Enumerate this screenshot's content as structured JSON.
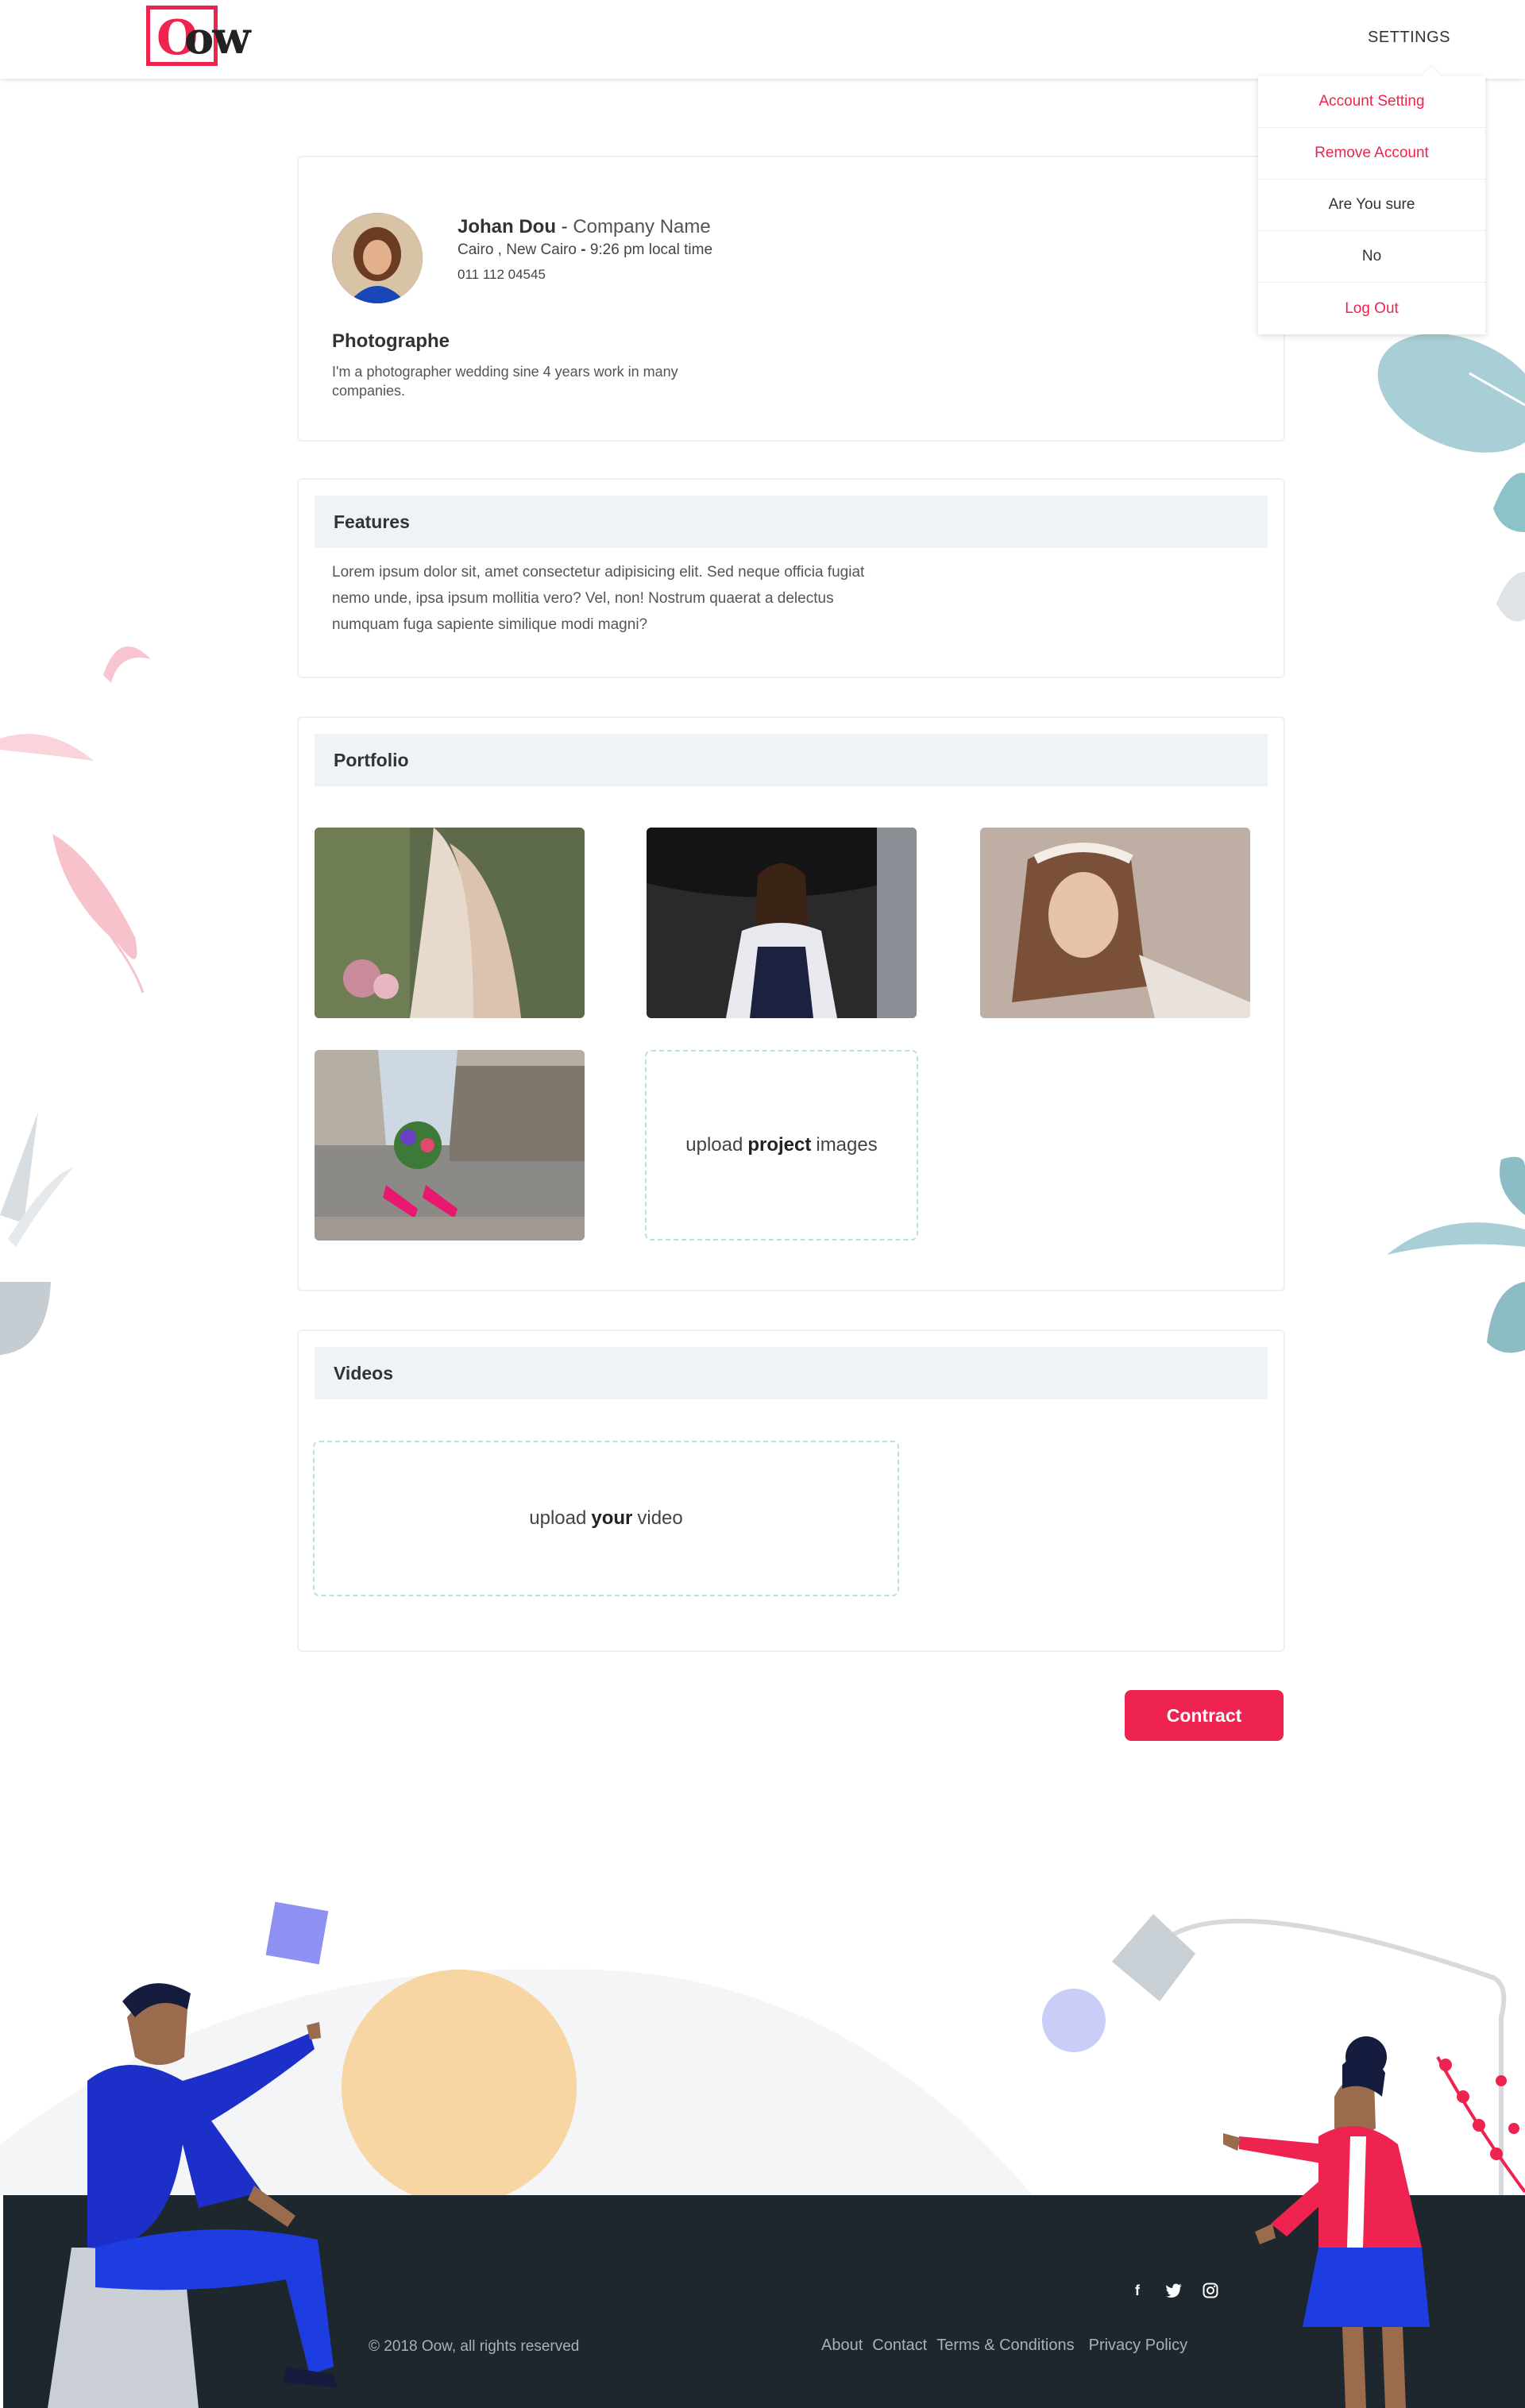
{
  "header": {
    "logo_text": "Oow",
    "settings_label": "SETTINGS"
  },
  "dropdown": {
    "items": [
      {
        "label": "Account Setting"
      },
      {
        "label": "Remove Account"
      },
      {
        "label": "Are You sure"
      },
      {
        "label": "No"
      },
      {
        "label": "Log Out"
      }
    ]
  },
  "profile": {
    "name": "Johan Dou",
    "separator": " - ",
    "company": "Company Name",
    "location": "Cairo , New Cairo",
    "local_time": "9:26 pm local time",
    "phone": "011 112 04545",
    "title": "Photographe",
    "bio": "I'm a photographer wedding sine 4 years work in many companies."
  },
  "features": {
    "heading": "Features",
    "text": "Lorem ipsum dolor sit, amet consectetur adipisicing elit. Sed neque officia fugiat nemo unde, ipsa ipsum mollitia vero? Vel, non! Nostrum quaerat a delectus numquam fuga sapiente similique modi magni?"
  },
  "portfolio": {
    "heading": "Portfolio",
    "upload_prefix": "upload",
    "upload_bold": "project",
    "upload_suffix": "images"
  },
  "videos": {
    "heading": "Videos",
    "upload_prefix": "upload",
    "upload_bold": "your",
    "upload_suffix": "video"
  },
  "contract_label": "Contract",
  "footer": {
    "copyright": "© 2018 Oow, all rights reserved",
    "links": [
      "About",
      "Contact",
      "Terms & Conditions",
      "Privacy Policy"
    ],
    "social_icons": [
      "facebook-icon",
      "twitter-icon",
      "instagram-icon"
    ]
  },
  "colors": {
    "accent": "#ee2350",
    "footer": "#1e262e",
    "section_header": "#f0f3f5",
    "upload_border": "#b6e3df"
  }
}
